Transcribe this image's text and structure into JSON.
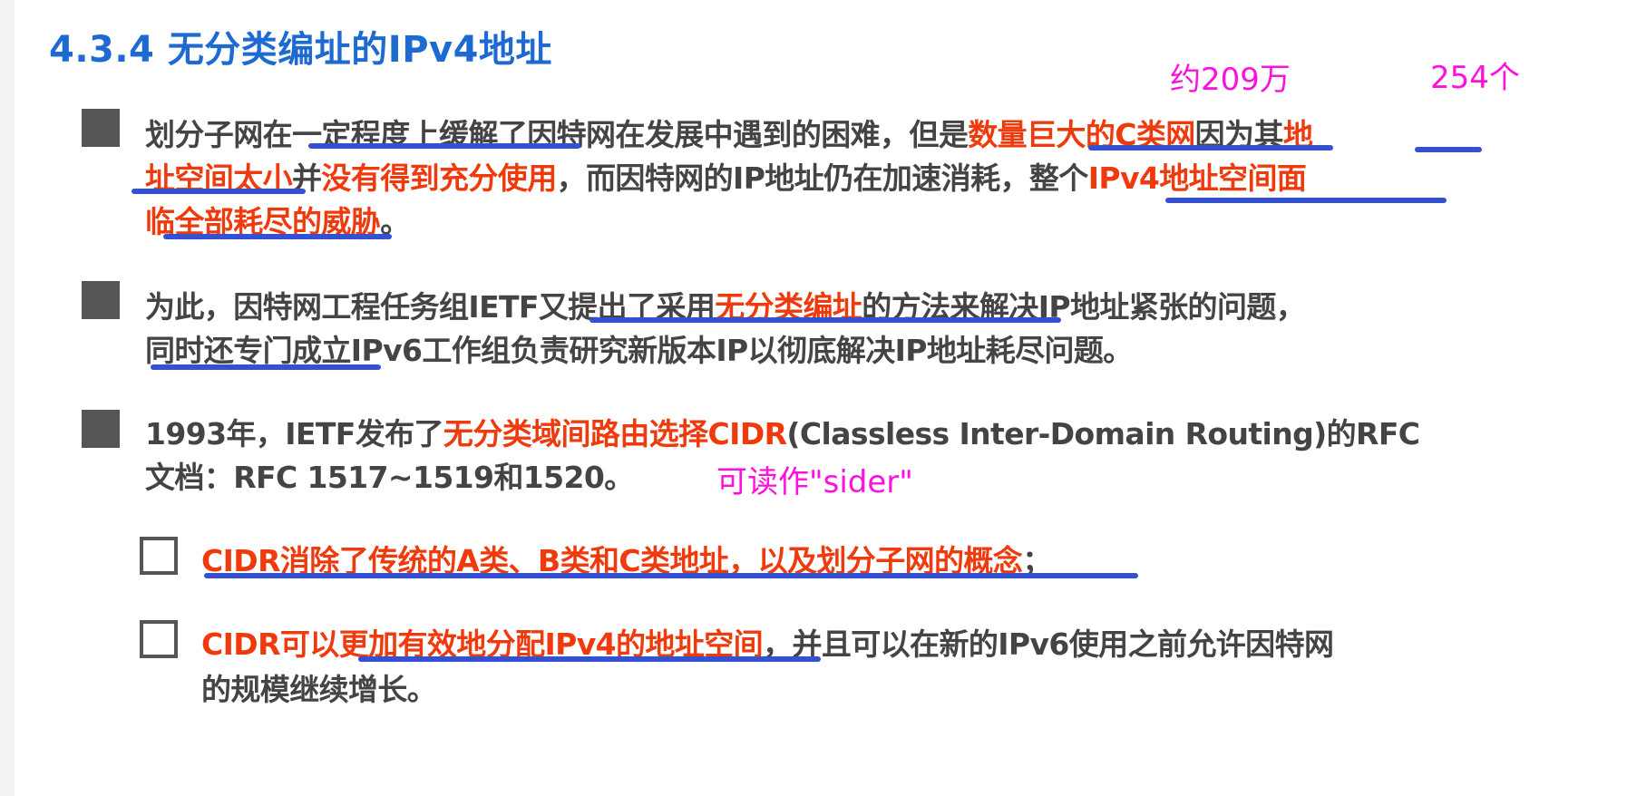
{
  "title": "4.3.4 无分类编址的IPv4地址",
  "annotations": {
    "approx_count": "约209万",
    "hosts_per_net": "254个",
    "pronounce": "可读作\"sider\""
  },
  "colors": {
    "title": "#1d6ad0",
    "highlight": "#ee3a0c",
    "body": "#444444",
    "underline": "#3651d0",
    "annotation": "#ff11dd"
  },
  "bullet1": {
    "l1a": "划分子网在",
    "l1b": "一定程度上缓解了",
    "l1c": "因特网在发展中遇到的困难，但是",
    "l1d": "数量巨大的C类网",
    "l1e": "因为其",
    "l1f": "地",
    "l2a": "址空间太小",
    "l2b": "并",
    "l2c": "没有得到充分使用",
    "l2d": "，而因特网的IP地址仍在加速消耗，",
    "l2e": "整个",
    "l2f": "IPv4地址空间面",
    "l3a": "临全部耗尽的威胁",
    "l3b": "。"
  },
  "bullet2": {
    "l1a": "为此，因特网工程任务组IETF又提出了采用",
    "l1b": "无分类编址",
    "l1c": "的方法来解决IP地址紧张的问题，",
    "l2": "同时还专门成立IPv6工作组负责研究新版本IP以彻底解决IP地址耗尽问题。"
  },
  "bullet3": {
    "l1a": "1993年，IETF发布了",
    "l1b": "无分类域间路由选择CIDR",
    "l1c": "(Classless Inter-Domain Routing)的RFC",
    "l2": "文档：RFC 1517~1519和1520。"
  },
  "sub1": {
    "a": "CIDR消除了传统的A类、B类和C类地址，以及划分子网的概念",
    "b": "；"
  },
  "sub2": {
    "a": "CIDR可以更加有效地分配IPv4的地址空间",
    "b": "，并且可以在新的IPv6使用之前允许因特网",
    "l2": "的规模继续增长。"
  }
}
